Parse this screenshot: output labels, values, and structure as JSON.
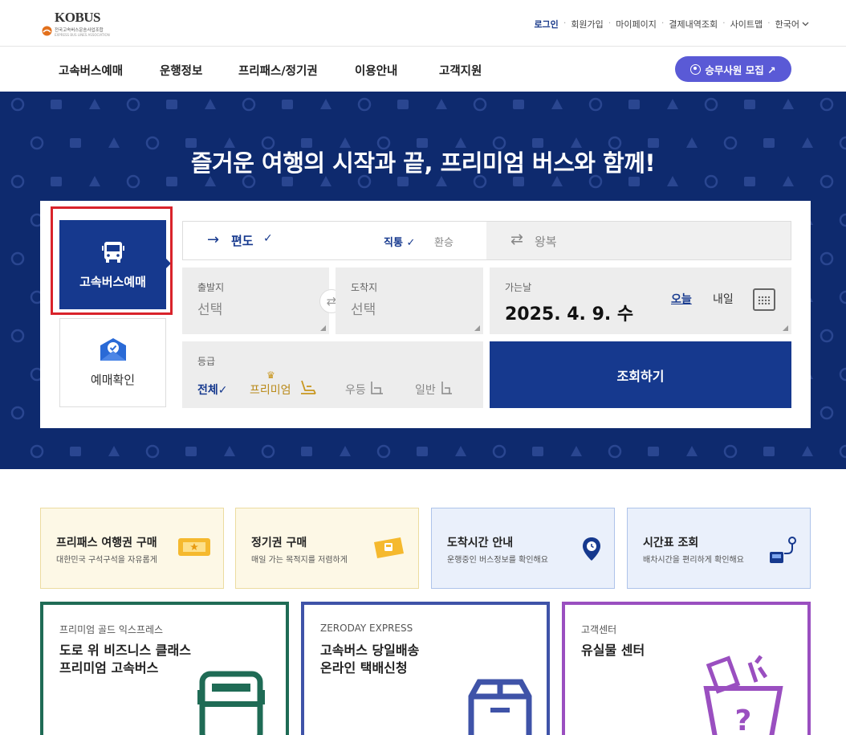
{
  "logo": {
    "brand": "KOBUS",
    "sub": "전국고속버스운송사업조합",
    "sub2": "EXPRESS BUS LINES ASSOCIATION"
  },
  "util": {
    "login": "로그인",
    "join": "회원가입",
    "mypage": "마이페이지",
    "payment": "결제내역조회",
    "sitemap": "사이트맵",
    "lang": "한국어"
  },
  "gnb": [
    "고속버스예매",
    "운행정보",
    "프리패스/정기권",
    "이용안내",
    "고객지원"
  ],
  "recruit": "승무사원 모집 ↗",
  "hero": {
    "title": "즐거운 여행의 시작과 끝, 프리미엄 버스와 함께!"
  },
  "tabs": {
    "reserve": "고속버스예매",
    "check": "예매확인"
  },
  "trip": {
    "oneway": "편도",
    "oneway_check": "✓",
    "direct": "직통 ✓",
    "transfer": "환승",
    "round": "왕복"
  },
  "departure": {
    "caption": "출발지",
    "value": "선택"
  },
  "arrival": {
    "caption": "도착지",
    "value": "선택"
  },
  "date": {
    "caption": "가는날",
    "value": "2025. 4. 9. 수",
    "today": "오늘",
    "tomorrow": "내일"
  },
  "grade": {
    "caption": "등급",
    "all": "전체✓",
    "premium": "프리미엄",
    "excellent": "우등",
    "normal": "일반"
  },
  "search_button": "조회하기",
  "quick_cards": [
    {
      "title": "프리패스 여행권 구매",
      "desc": "대한민국 구석구석을 자유롭게"
    },
    {
      "title": "정기권 구매",
      "desc": "매일 가는 목적지를 저렴하게"
    },
    {
      "title": "도착시간 안내",
      "desc": "운행중인 버스정보를 확인해요"
    },
    {
      "title": "시간표 조회",
      "desc": "배차시간을 편리하게 확인해요"
    }
  ],
  "big_cards": [
    {
      "kicker": "프리미엄 골드 익스프레스",
      "line1": "도로 위 비즈니스 클래스",
      "line2": "프리미엄 고속버스"
    },
    {
      "kicker": "ZERODAY EXPRESS",
      "line1": "고속버스 당일배송",
      "line2": "온라인 택배신청"
    },
    {
      "kicker": "고객센터",
      "line1": "유실물 센터",
      "line2": ""
    }
  ],
  "colors": {
    "navy": "#16398e",
    "hero_bg": "#0e2a6e",
    "purple": "#5a5ad6",
    "highlight": "#d9232b"
  }
}
